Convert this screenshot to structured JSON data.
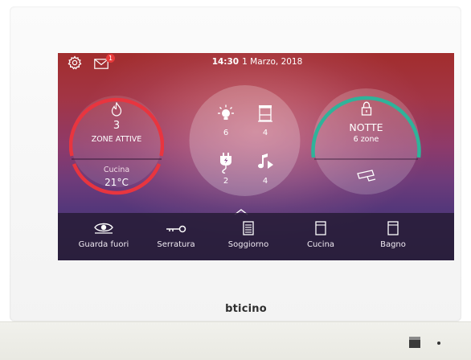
{
  "status_bar": {
    "time": "14:30",
    "date": "1 Marzo, 2018",
    "notification_count": "1",
    "icons": [
      "gear-icon",
      "envelope-icon"
    ]
  },
  "heating_widget": {
    "icon": "flame-icon",
    "count": "3",
    "label": "ZONE ATTIVE",
    "zone_name": "Cucina",
    "temperature": "21°C",
    "ring_color": "#e8353f"
  },
  "devices_widget": {
    "lights": {
      "icon": "lightbulb-icon",
      "count": "6"
    },
    "shutters": {
      "icon": "shutter-icon",
      "count": "4"
    },
    "energy": {
      "icon": "plug-icon",
      "count": "2"
    },
    "sound": {
      "icon": "music-icon",
      "count": "4"
    }
  },
  "alarm_widget": {
    "icon": "padlock-icon",
    "mode": "NOTTE",
    "zones": "6 zone",
    "camera_icon": "security-camera-icon",
    "ring_color": "#2fb39a"
  },
  "bottom_nav": {
    "expand_icon": "chevron-up-icon",
    "items": [
      {
        "label": "Guarda fuori",
        "icon": "eye-icon"
      },
      {
        "label": "Serratura",
        "icon": "key-icon"
      },
      {
        "label": "Soggiorno",
        "icon": "shutter-icon"
      },
      {
        "label": "Cucina",
        "icon": "door-icon"
      },
      {
        "label": "Bagno",
        "icon": "door-icon"
      }
    ]
  },
  "device": {
    "brand": "bticino"
  }
}
